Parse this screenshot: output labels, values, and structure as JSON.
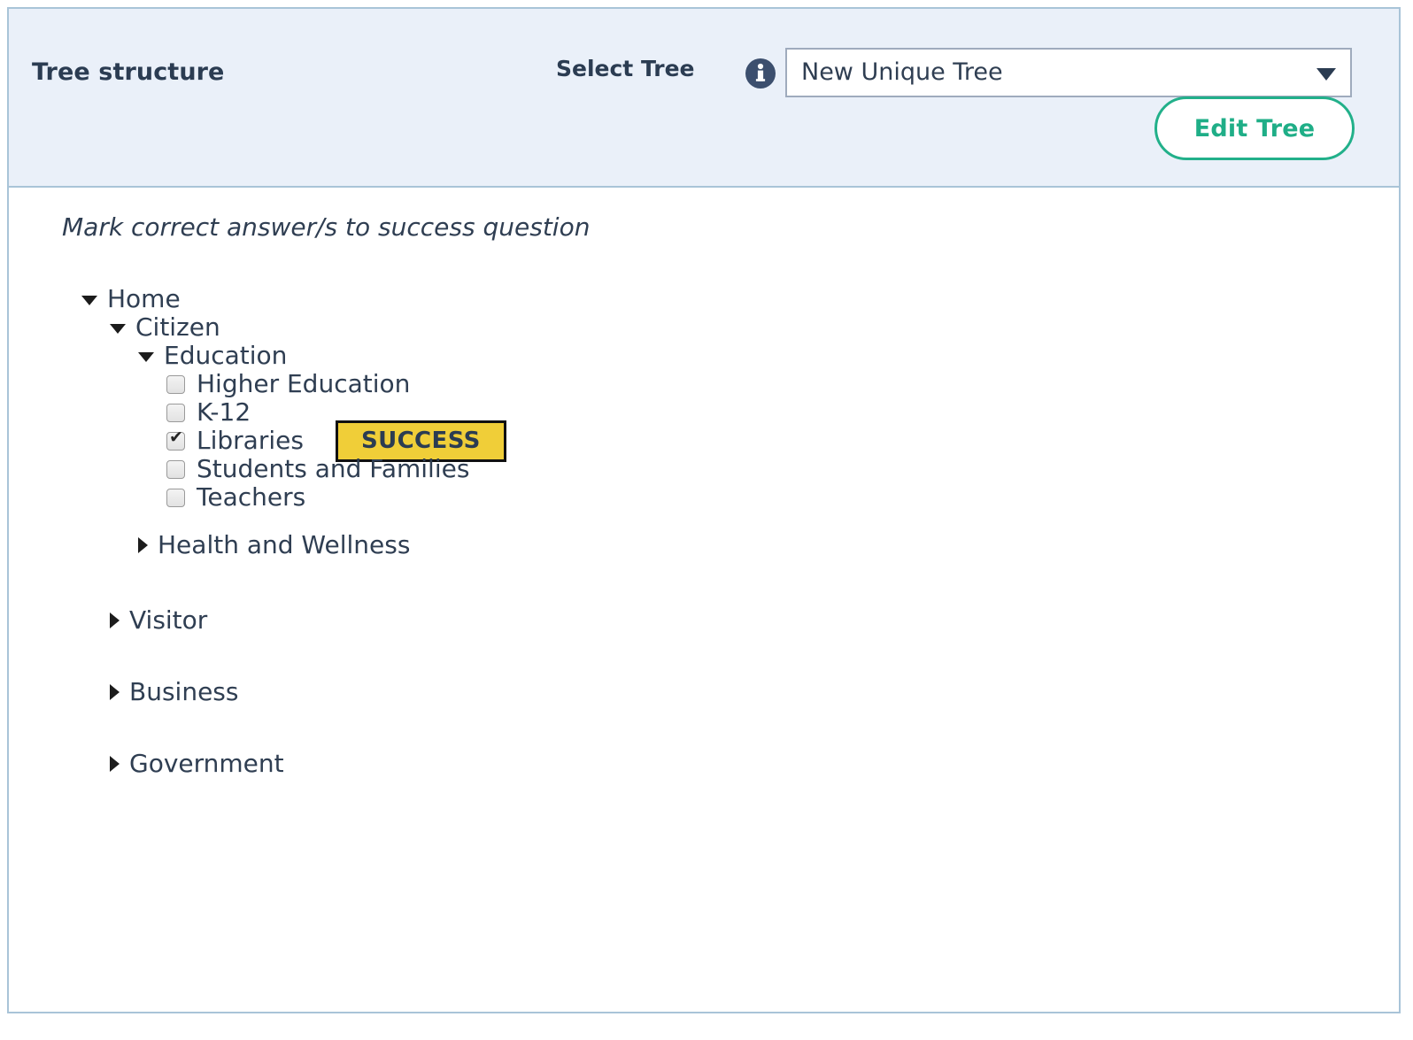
{
  "header": {
    "title": "Tree structure",
    "select_label": "Select Tree",
    "info_icon": "info-icon",
    "select_value": "New Unique Tree",
    "caret_icon": "chevron-down-icon",
    "edit_button_label": "Edit Tree"
  },
  "body": {
    "instruction": "Mark correct answer/s to success question"
  },
  "tree": {
    "nodes": [
      {
        "label": "Home",
        "level": 0,
        "type": "expander",
        "state": "expanded",
        "icon": "triangle-down-icon"
      },
      {
        "label": "Citizen",
        "level": 1,
        "type": "expander",
        "state": "expanded",
        "icon": "triangle-down-icon"
      },
      {
        "label": "Education",
        "level": 2,
        "type": "expander",
        "state": "expanded",
        "icon": "triangle-down-icon"
      },
      {
        "label": "Higher Education",
        "level": 3,
        "type": "checkbox",
        "checked": false
      },
      {
        "label": "K-12",
        "level": 3,
        "type": "checkbox",
        "checked": false
      },
      {
        "label": "Libraries",
        "level": 3,
        "type": "checkbox",
        "checked": true,
        "badge": "SUCCESS"
      },
      {
        "label": "Students and Families",
        "level": 3,
        "type": "checkbox",
        "checked": false
      },
      {
        "label": "Teachers",
        "level": 3,
        "type": "checkbox",
        "checked": false
      },
      {
        "label": "Health and Wellness",
        "level": 2,
        "type": "expander",
        "state": "collapsed",
        "icon": "triangle-right-icon",
        "gap_before": 22
      },
      {
        "label": "Visitor",
        "level": 1,
        "type": "expander",
        "state": "collapsed",
        "icon": "triangle-right-icon",
        "gap_before": 53
      },
      {
        "label": "Business",
        "level": 1,
        "type": "expander",
        "state": "collapsed",
        "icon": "triangle-right-icon",
        "gap_before": 49
      },
      {
        "label": "Government",
        "level": 1,
        "type": "expander",
        "state": "collapsed",
        "icon": "triangle-right-icon",
        "gap_before": 49
      }
    ]
  },
  "colors": {
    "header_bg": "#eaf0f9",
    "panel_border": "#a9c4d8",
    "text": "#2f3e52",
    "accent_teal": "#22b08a",
    "badge_bg": "#f0ce38",
    "info_icon": "#3c4f6e"
  }
}
